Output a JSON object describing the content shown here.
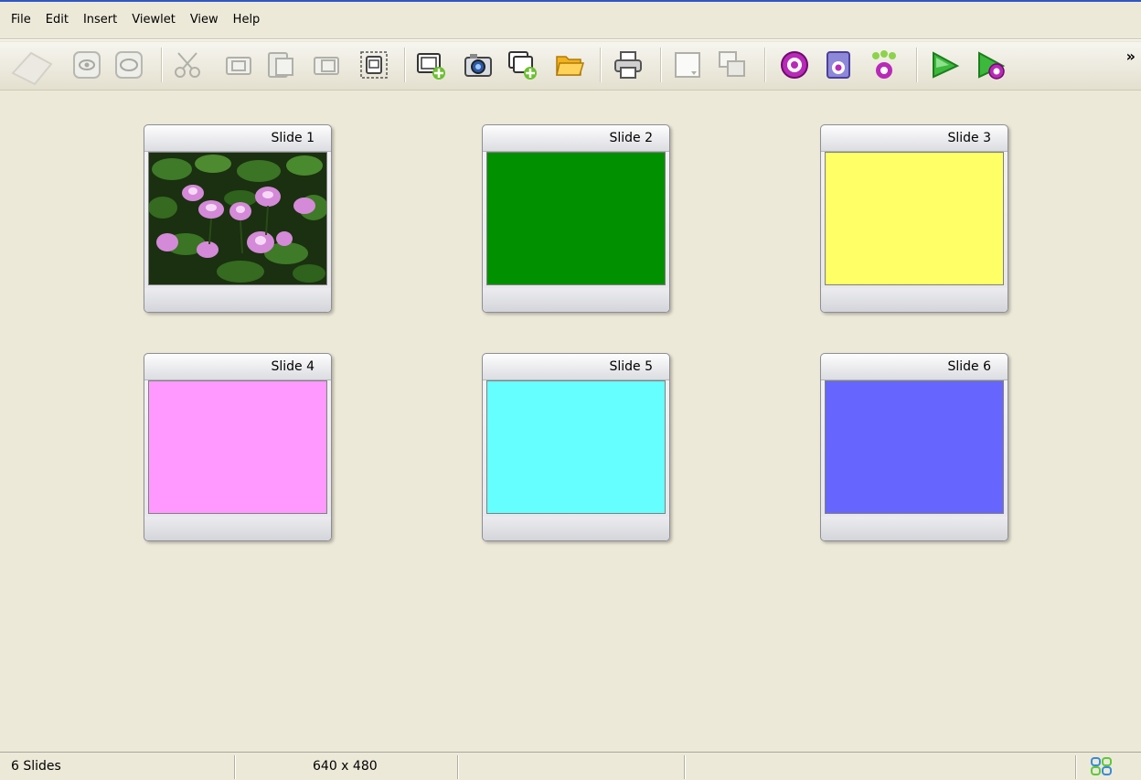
{
  "menu": [
    "File",
    "Edit",
    "Insert",
    "Viewlet",
    "View",
    "Help"
  ],
  "toolbar": {
    "icons": [
      "slide-shape-icon",
      "preview-eye-icon",
      "oval-icon",
      "cut-icon",
      "copy-icon",
      "paste-icon",
      "paste-special-icon",
      "select-frame-icon",
      "new-slide-icon",
      "camera-icon",
      "duplicate-slide-icon",
      "open-folder-icon",
      "print-icon",
      "blank-slide-icon",
      "slide-properties-icon",
      "record-icon",
      "audio-file-icon",
      "branching-icon",
      "play-icon",
      "play-record-icon"
    ],
    "overflow": "»"
  },
  "slides": [
    {
      "label": "Slide 1",
      "kind": "image",
      "color": "#1f3a14"
    },
    {
      "label": "Slide 2",
      "kind": "color",
      "color": "#009000"
    },
    {
      "label": "Slide 3",
      "kind": "color",
      "color": "#ffff66"
    },
    {
      "label": "Slide 4",
      "kind": "color",
      "color": "#ff99ff"
    },
    {
      "label": "Slide 5",
      "kind": "color",
      "color": "#66ffff"
    },
    {
      "label": "Slide 6",
      "kind": "color",
      "color": "#6666ff"
    }
  ],
  "status": {
    "count": "6 Slides",
    "size": "640 x 480",
    "view_icon": "thumbnail-view-icon"
  }
}
